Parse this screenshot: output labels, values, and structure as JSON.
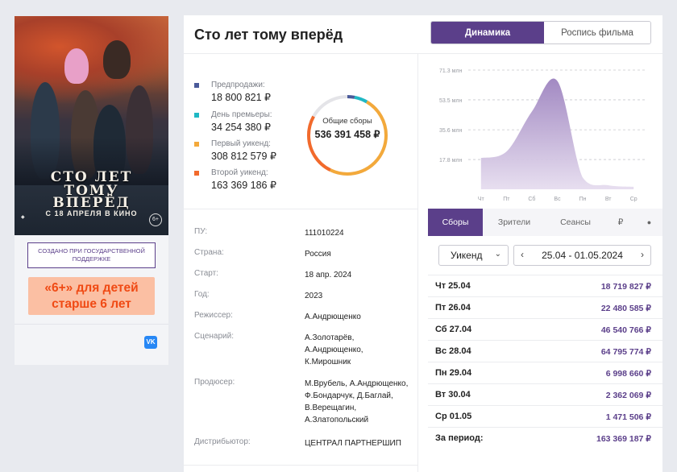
{
  "poster": {
    "title_lines": [
      "СТО ЛЕТ",
      "ТОМУ",
      "ВПЕРЁД"
    ],
    "release": "С 18 АПРЕЛЯ В КИНО",
    "age": "6+"
  },
  "sidebar": {
    "gov_support": "СОЗДАНО ПРИ ГОСУДАРСТВЕННОЙ ПОДДЕРЖКЕ",
    "age_notice": "«6+» для детей старше 6 лет",
    "vk": "VK"
  },
  "header": {
    "title": "Сто лет тому вперёд",
    "tab_dynamics": "Динамика",
    "tab_schedule": "Роспись фильма"
  },
  "stats": [
    {
      "label": "Предпродажи:",
      "value": "18 800 821 ₽",
      "color": "#4a5a9a"
    },
    {
      "label": "День премьеры:",
      "value": "34 254 380 ₽",
      "color": "#1fb8c4"
    },
    {
      "label": "Первый уикенд:",
      "value": "308 812 579 ₽",
      "color": "#f3a93b"
    },
    {
      "label": "Второй уикенд:",
      "value": "163 369 186 ₽",
      "color": "#f26a2c"
    }
  ],
  "donut": {
    "label": "Общие сборы",
    "total": "536 391 458 ₽",
    "segments": [
      18800821,
      34254380,
      308812579,
      163369186
    ],
    "colors": [
      "#4a5a9a",
      "#1fb8c4",
      "#f3a93b",
      "#f26a2c"
    ],
    "remainder_color": "#e4e4e8"
  },
  "info": [
    {
      "key": "ПУ:",
      "value": "111010224"
    },
    {
      "key": "Страна:",
      "value": "Россия"
    },
    {
      "key": "Старт:",
      "value": "18 апр. 2024"
    },
    {
      "key": "Год:",
      "value": "2023"
    },
    {
      "key": "Режиссер:",
      "value": "А.Андрющенко"
    },
    {
      "key": "Сценарий:",
      "value": "А.Золотарёв,\nА.Андрющенко,\nК.Мирошник"
    },
    {
      "key": "Продюсер:",
      "value": "М.Врубель, А.Андрющенко,\nФ.Бондарчук, Д.Баглай,\nВ.Верещагин,\nА.Златопольский"
    },
    {
      "key": "Дистрибьютор:",
      "value": "ЦЕНТРАЛ ПАРТНЕРШИП"
    }
  ],
  "chart_data": {
    "type": "area",
    "categories": [
      "Чт",
      "Пт",
      "Сб",
      "Вс",
      "Пн",
      "Вт",
      "Ср"
    ],
    "values": [
      18.7,
      22.5,
      46.5,
      64.8,
      7.0,
      2.4,
      1.5
    ],
    "yticks": [
      "71.3 млн",
      "53.5 млн",
      "35.6 млн",
      "17.8 млн"
    ],
    "ytick_values": [
      71.3,
      53.5,
      35.6,
      17.8
    ],
    "ylim": [
      0,
      71.3
    ],
    "unit": "млн",
    "color": "#b9a6cf",
    "grid": true
  },
  "tabs": [
    "Сборы",
    "Зрители",
    "Сеансы",
    "₽",
    "👤"
  ],
  "filter": {
    "period": "Уикенд",
    "range": "25.04 - 01.05.2024"
  },
  "days": [
    {
      "day": "Чт 25.04",
      "sum": "18 719 827 ₽"
    },
    {
      "day": "Пт 26.04",
      "sum": "22 480 585 ₽"
    },
    {
      "day": "Сб 27.04",
      "sum": "46 540 766 ₽"
    },
    {
      "day": "Вс 28.04",
      "sum": "64 795 774 ₽"
    },
    {
      "day": "Пн 29.04",
      "sum": "6 998 660 ₽"
    },
    {
      "day": "Вт 30.04",
      "sum": "2 362 069 ₽"
    },
    {
      "day": "Ср 01.05",
      "sum": "1 471 506 ₽"
    },
    {
      "day": "За период:",
      "sum": "163 369 187 ₽"
    }
  ]
}
